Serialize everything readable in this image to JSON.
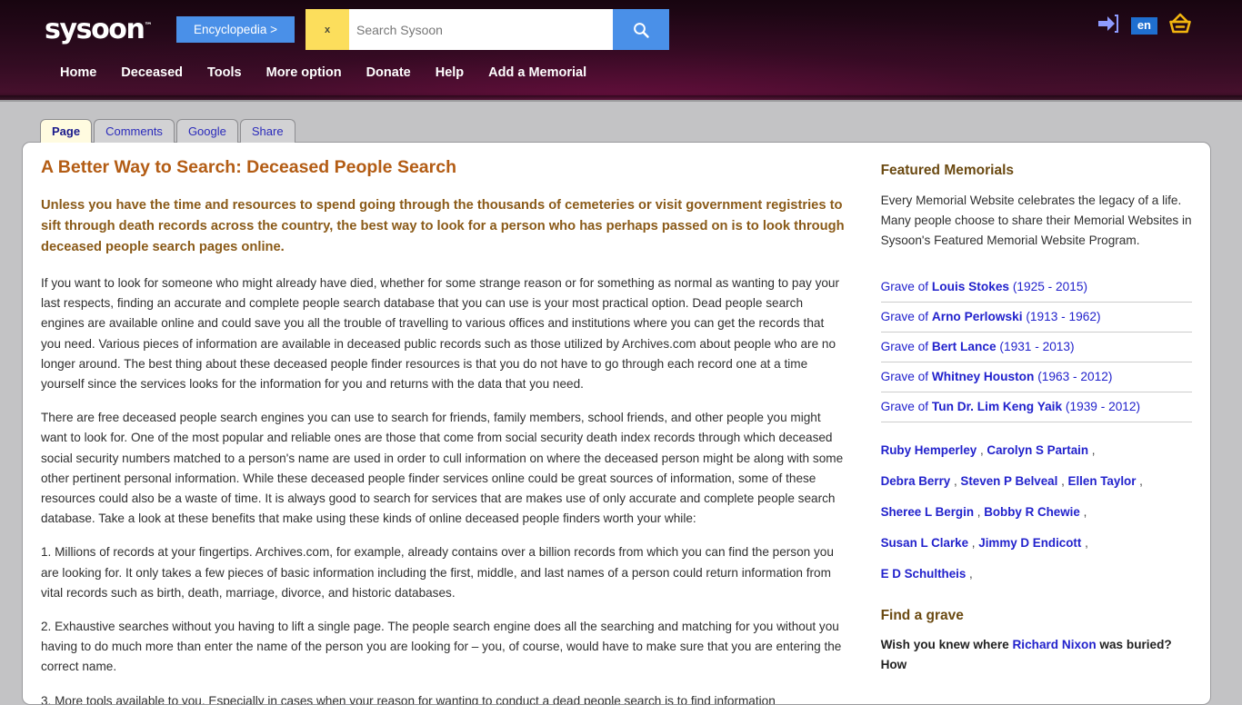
{
  "header": {
    "logo": "sysoon",
    "logo_tm": "™",
    "encyclopedia_label": "Encyclopedia >",
    "search": {
      "clear_label": "x",
      "placeholder": "Search Sysoon",
      "value": "",
      "button_icon": "search-icon"
    },
    "right_icons": [
      {
        "name": "login-arrow-icon",
        "label": ""
      },
      {
        "name": "language-badge",
        "label": "en"
      },
      {
        "name": "basket-icon",
        "label": ""
      }
    ],
    "lang": "en",
    "nav": [
      {
        "label": "Home"
      },
      {
        "label": "Deceased"
      },
      {
        "label": "Tools"
      },
      {
        "label": "More option"
      },
      {
        "label": "Donate"
      },
      {
        "label": "Help"
      },
      {
        "label": "Add a Memorial"
      }
    ],
    "colors": {
      "accent_blue": "#4a90e8",
      "clear_yellow": "#fcde5c",
      "lang_blue": "#1f6fd0",
      "basket_orange": "#f2b50f"
    }
  },
  "tabs": [
    {
      "label": "Page",
      "active": true
    },
    {
      "label": "Comments",
      "active": false
    },
    {
      "label": "Google",
      "active": false
    },
    {
      "label": "Share",
      "active": false
    }
  ],
  "main": {
    "title": "A Better Way to Search: Deceased People Search",
    "lede": "Unless you have the time and resources to spend going through the thousands of cemeteries or visit government registries to sift through death records across the country, the best way to look for a person who has perhaps passed on is to look through deceased people search pages online.",
    "paragraphs": [
      "If you want to look for someone who might already have died, whether for some strange reason or for something as normal as wanting to pay your last respects, finding an accurate and complete people search database that you can use is your most practical option. Dead people search engines are available online and could save you all the trouble of travelling to various offices and institutions where you can get the records that you need. Various pieces of information are available in deceased public records such as those utilized by Archives.com about people who are no longer around. The best thing about these deceased people finder resources is that you do not have to go through each record one at a time yourself since the services looks for the information for you and returns with the data that you need.",
      "There are free deceased people search engines you can use to search for friends, family members, school friends, and other people you might want to look for. One of the most popular and reliable ones are those that come from social security death index records through which deceased social security numbers matched to a person's name are used in order to cull information on where the deceased person might be along with some other pertinent personal information. While these deceased people finder services online could be great sources of information, some of these resources could also be a waste of time. It is always good to search for services that are makes use of only accurate and complete people search database. Take a look at these benefits that make using these kinds of online deceased people finders worth your while:",
      "1. Millions of records at your fingertips. Archives.com, for example, already contains over a billion records from which you can find the person you are looking for. It only takes a few pieces of basic information including the first, middle, and last names of a person could return information from vital records such as birth, death, marriage, divorce, and historic databases.",
      "2. Exhaustive searches without you having to lift a single page. The people search engine does all the searching and matching for you without you having to do much more than enter the name of the person you are looking for – you, of course, would have to make sure that you are entering the correct name.",
      "3. More tools available to you. Especially in cases when your reason for wanting to conduct a dead people search is to find information"
    ]
  },
  "sidebar": {
    "featured_title": "Featured Memorials",
    "featured_text": "Every Memorial Website celebrates the legacy of a life. Many people choose to share their Memorial Websites in Sysoon's Featured Memorial Website Program.",
    "graves": [
      {
        "prefix": "Grave of ",
        "name": "Louis Stokes",
        "years": " (1925 - 2015)"
      },
      {
        "prefix": "Grave of ",
        "name": "Arno Perlowski",
        "years": " (1913 - 1962)"
      },
      {
        "prefix": "Grave of ",
        "name": "Bert Lance",
        "years": " (1931 - 2013)"
      },
      {
        "prefix": "Grave of ",
        "name": "Whitney Houston",
        "years": " (1963 - 2012)"
      },
      {
        "prefix": "Grave of ",
        "name": "Tun Dr. Lim Keng Yaik",
        "years": " (1939 - 2012)"
      }
    ],
    "name_lines": [
      [
        {
          "name": "Ruby Hemperley"
        },
        {
          "name": "Carolyn S Partain"
        }
      ],
      [
        {
          "name": "Debra Berry"
        },
        {
          "name": "Steven P Belveal"
        },
        {
          "name": "Ellen Taylor"
        }
      ],
      [
        {
          "name": "Sheree L Bergin"
        },
        {
          "name": "Bobby R Chewie"
        }
      ],
      [
        {
          "name": "Susan L Clarke"
        },
        {
          "name": "Jimmy D Endicott"
        }
      ],
      [
        {
          "name": "E D Schultheis"
        }
      ]
    ],
    "find_grave_title": "Find a grave",
    "find_grave_pre": "Wish you knew where ",
    "find_grave_link": "Richard Nixon",
    "find_grave_post": " was buried? How"
  }
}
